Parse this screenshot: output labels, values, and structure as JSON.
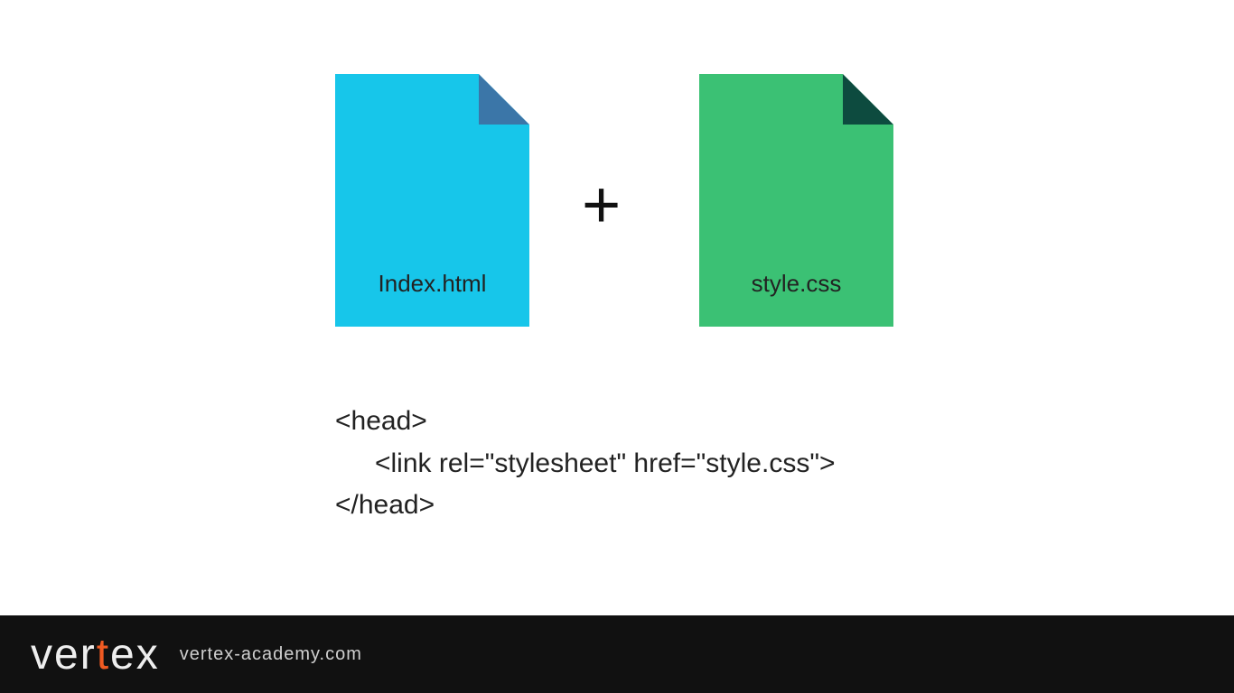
{
  "files": {
    "html": {
      "label": "Index.html"
    },
    "css": {
      "label": "style.css"
    }
  },
  "plus": "+",
  "code": {
    "line1": "<head>",
    "line2": "<link rel=\"stylesheet\" href=\"style.css\">",
    "line3": "</head>"
  },
  "footer": {
    "logo_v": "v",
    "logo_e1": "e",
    "logo_r": "r",
    "logo_t": "t",
    "logo_e2": "e",
    "logo_x": "x",
    "url": "vertex-academy.com"
  }
}
